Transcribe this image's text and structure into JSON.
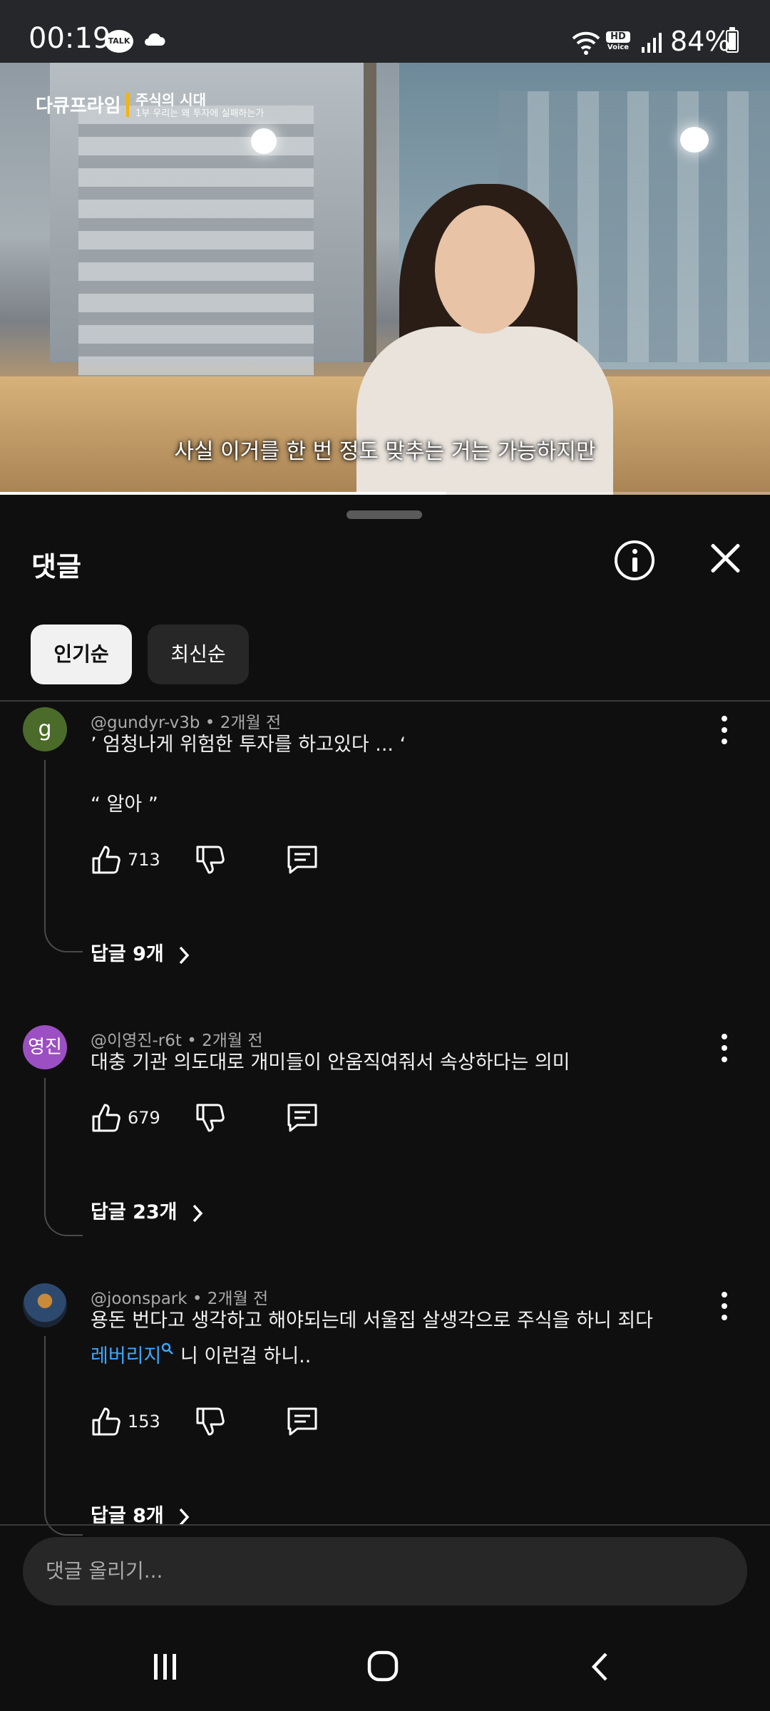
{
  "status_bar": {
    "time": "00:19",
    "talk_badge": "TALK",
    "hd_label": "HD",
    "voice_label": "Voice",
    "battery_percent": "84%",
    "battery_level": 0.84
  },
  "video": {
    "channel_logo": "다큐프라임",
    "series_title": "주식의 시대",
    "episode_title": "1부 우리는 왜 투자에 실패하는가",
    "subtitle": "사실 이거를 한 번 정도 맞추는 거는 가능하지만",
    "progress_fraction": 0.58
  },
  "sheet": {
    "title": "댓글",
    "sort_chips": [
      {
        "label": "인기순",
        "active": true
      },
      {
        "label": "최신순",
        "active": false
      }
    ]
  },
  "comments": [
    {
      "avatar": "g",
      "avatar_color": "#4b6b2a",
      "author": "@gundyr-v3b",
      "time": "2개월 전",
      "lines": [
        "’ 엄청나게 위험한 투자를 하고있다 ... ‘",
        "",
        "“ 알아 ”"
      ],
      "likes": "713",
      "replies": "답글 9개"
    },
    {
      "avatar": "영진",
      "avatar_color": "#9c4fc2",
      "author": "@이영진-r6t",
      "time": "2개월 전",
      "lines": [
        "대충 기관 의도대로 개미들이 안움직여줘서 속상하다는 의미"
      ],
      "likes": "679",
      "replies": "답글 23개"
    },
    {
      "avatar": "",
      "avatar_color": "#2d4a6e",
      "author": "@joonspark",
      "time": "2개월 전",
      "line1": "용돈 번다고 생각하고 해야되는데 서울집 살생각으로 주식을 하니 죄다",
      "line2_link": "레버리지",
      "line2_rest": " 니 이런걸 하니..",
      "likes": "153",
      "replies": "답글 8개"
    }
  ],
  "composer": {
    "placeholder": "댓글 올리기..."
  },
  "colors": {
    "background": "#0f0f0f",
    "link": "#3ea6ff",
    "chip_active": "#f1f1f1",
    "chip_inactive": "#272727"
  }
}
